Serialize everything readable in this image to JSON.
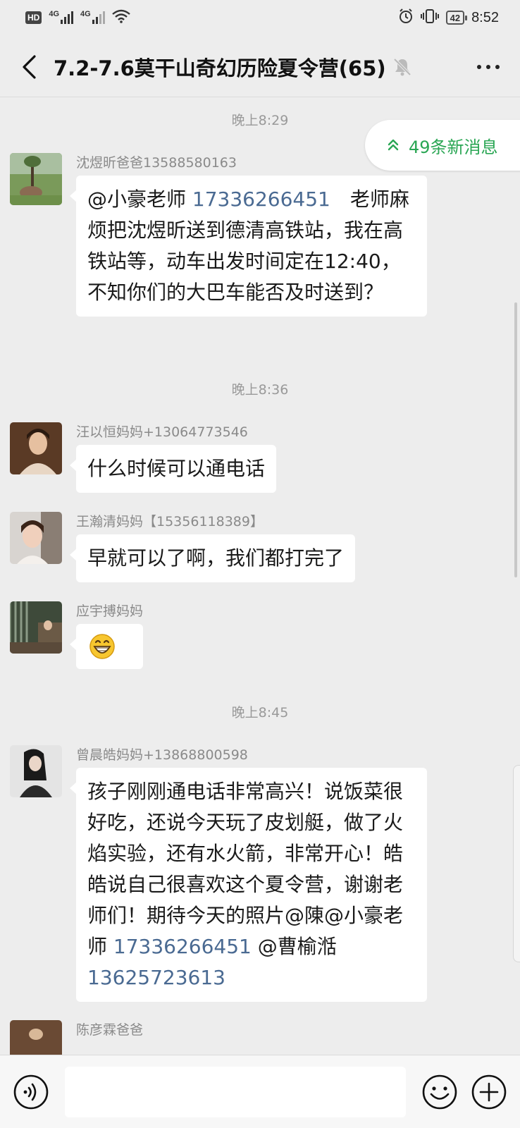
{
  "status_bar": {
    "hd": "HD",
    "network_1": "4G",
    "network_2": "4G",
    "battery": "42",
    "time": "8:52"
  },
  "header": {
    "title": "7.2-7.6莫干山奇幻历险夏令营(65)",
    "icons": [
      "back-arrow-icon",
      "mute-bell-icon",
      "more-icon"
    ]
  },
  "new_messages": {
    "label": "49条新消息",
    "icon": "double-chevron-up-icon",
    "color": "#2aa654"
  },
  "chat": {
    "time_separators": [
      "晚上8:29",
      "晚上8:36",
      "晚上8:45"
    ],
    "messages": [
      {
        "sender": "沈煜昕爸爸13588580163",
        "text_prefix": "@小豪老师 ",
        "phone": "17336266451",
        "text_suffix": "　老师麻烦把沈煜昕送到德清高铁站，我在高铁站等，动车出发时间定在12:40，不知你们的大巴车能否及时送到？"
      },
      {
        "sender": "汪以恒妈妈+13064773546",
        "text": "什么时候可以通电话"
      },
      {
        "sender": "王瀚清妈妈【15356118389】",
        "text": "早就可以了啊，我们都打完了"
      },
      {
        "sender": "应宇搏妈妈",
        "text": "😁"
      },
      {
        "sender": "曾晨皓妈妈+13868800598",
        "text_main": "孩子刚刚通电话非常高兴！说饭菜很好吃，还说今天玩了皮划艇，做了火焰实验，还有水火箭，非常开心！皓皓说自己很喜欢这个夏令营，谢谢老师们！期待今天的照片@陳@小豪老师 ",
        "phone_1": "17336266451",
        "mid": " @曹榆湉",
        "phone_2": "13625723613"
      },
      {
        "sender": "陈彦霖爸爸"
      }
    ]
  },
  "input_bar": {
    "placeholder": "",
    "icons": [
      "voice-icon",
      "emoji-icon",
      "plus-icon"
    ]
  },
  "colors": {
    "background": "#ededed",
    "bubble": "#ffffff",
    "link_phone": "#4a6a92",
    "accent_green": "#2aa654"
  }
}
